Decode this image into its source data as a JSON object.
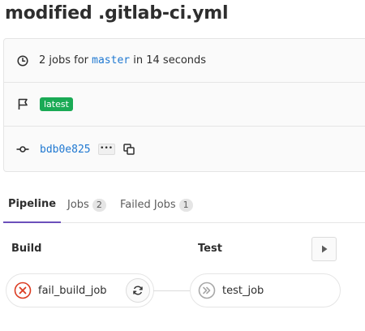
{
  "page": {
    "title": "modified .gitlab-ci.yml"
  },
  "info": {
    "jobs_prefix": "2 jobs for",
    "branch": "master",
    "jobs_suffix": "in 14 seconds",
    "badge": "latest",
    "sha": "bdb0e825",
    "ellipsis": "•••"
  },
  "tabs": [
    {
      "label": "Pipeline",
      "count": null,
      "active": true
    },
    {
      "label": "Jobs",
      "count": "2",
      "active": false
    },
    {
      "label": "Failed Jobs",
      "count": "1",
      "active": false
    }
  ],
  "stages": [
    {
      "title": "Build",
      "jobs": [
        {
          "name": "fail_build_job",
          "status": "failed",
          "action": "retry"
        }
      ]
    },
    {
      "title": "Test",
      "jobs": [
        {
          "name": "test_job",
          "status": "skipped"
        }
      ]
    }
  ],
  "colors": {
    "failed": "#db3b21",
    "skipped": "#a7a7a7",
    "accent": "#6b4fbb",
    "link": "#1f78d1",
    "success": "#1aaa55"
  }
}
